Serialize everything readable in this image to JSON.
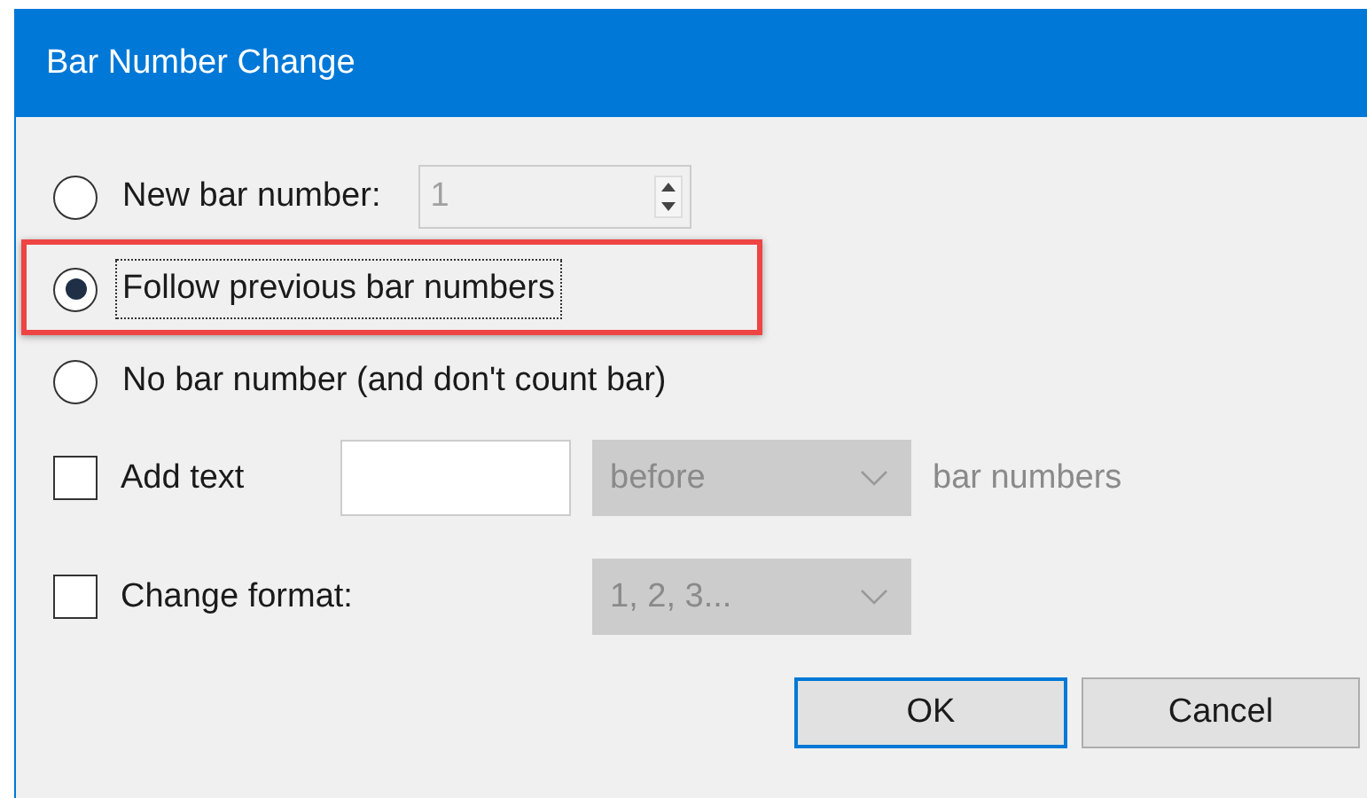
{
  "window": {
    "title": "Bar Number Change"
  },
  "options": [
    {
      "label": "New bar number:",
      "selected": false,
      "focused": false,
      "highlighted": false,
      "spin": {
        "value": "1",
        "disabled": true
      }
    },
    {
      "label": "Follow previous bar numbers",
      "selected": true,
      "focused": true,
      "highlighted": true
    },
    {
      "label": "No bar number (and don't count bar)",
      "selected": false,
      "focused": false,
      "highlighted": false
    }
  ],
  "add_text": {
    "label": "Add text",
    "checked": false,
    "position": {
      "value": "before",
      "disabled": true
    },
    "suffix": "bar numbers"
  },
  "change_format": {
    "label": "Change format:",
    "checked": false,
    "format": {
      "value": "1, 2, 3...",
      "disabled": true
    }
  },
  "buttons": [
    {
      "label": "OK",
      "default": true
    },
    {
      "label": "Cancel",
      "default": false
    }
  ]
}
